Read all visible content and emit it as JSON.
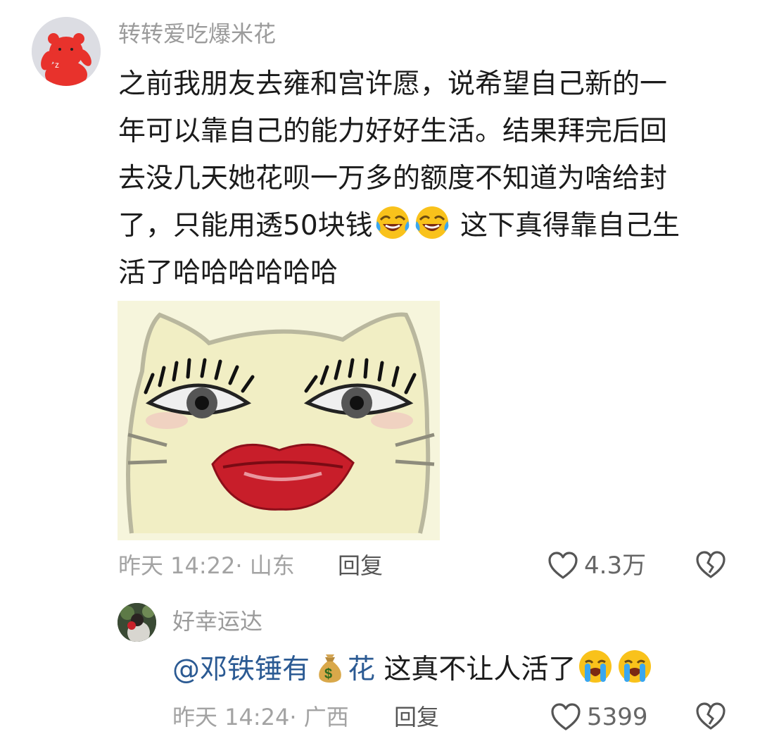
{
  "comment": {
    "username": "转转爱吃爆米花",
    "lines": [
      "之前我朋友去雍和宫许愿，说希望自己新的一",
      "年可以靠自己的能力好好生活。结果拜完后回",
      "去没几天她花呗一万多的额度不知道为啥给封"
    ],
    "line4_before_emoji": "了，只能用透50块钱",
    "line4_after_emoji": " 这下真得靠自己生",
    "line5": "活了哈哈哈哈哈哈",
    "emoji": "laughing-crying-emoji",
    "image": "hello-kitty-lips-lashes-meme",
    "time_location": "昨天 14:22· 山东",
    "reply_label": "回复",
    "like_count": "4.3万"
  },
  "reply": {
    "username": "好幸运达",
    "mention": "@邓铁锤有",
    "mention_icon": "money-bag-emoji",
    "mention_suffix": "花",
    "text": " 这真不让人活了",
    "emoji": "loudly-crying-emoji",
    "time_location": "昨天 14:24· 广西",
    "reply_label": "回复",
    "like_count": "5399"
  },
  "colors": {
    "username": "#9b9b9b",
    "body_text": "#1b1b1b",
    "meta_text": "#a3a3a3",
    "mention": "#2b5a93",
    "icon_stroke": "#555555"
  }
}
